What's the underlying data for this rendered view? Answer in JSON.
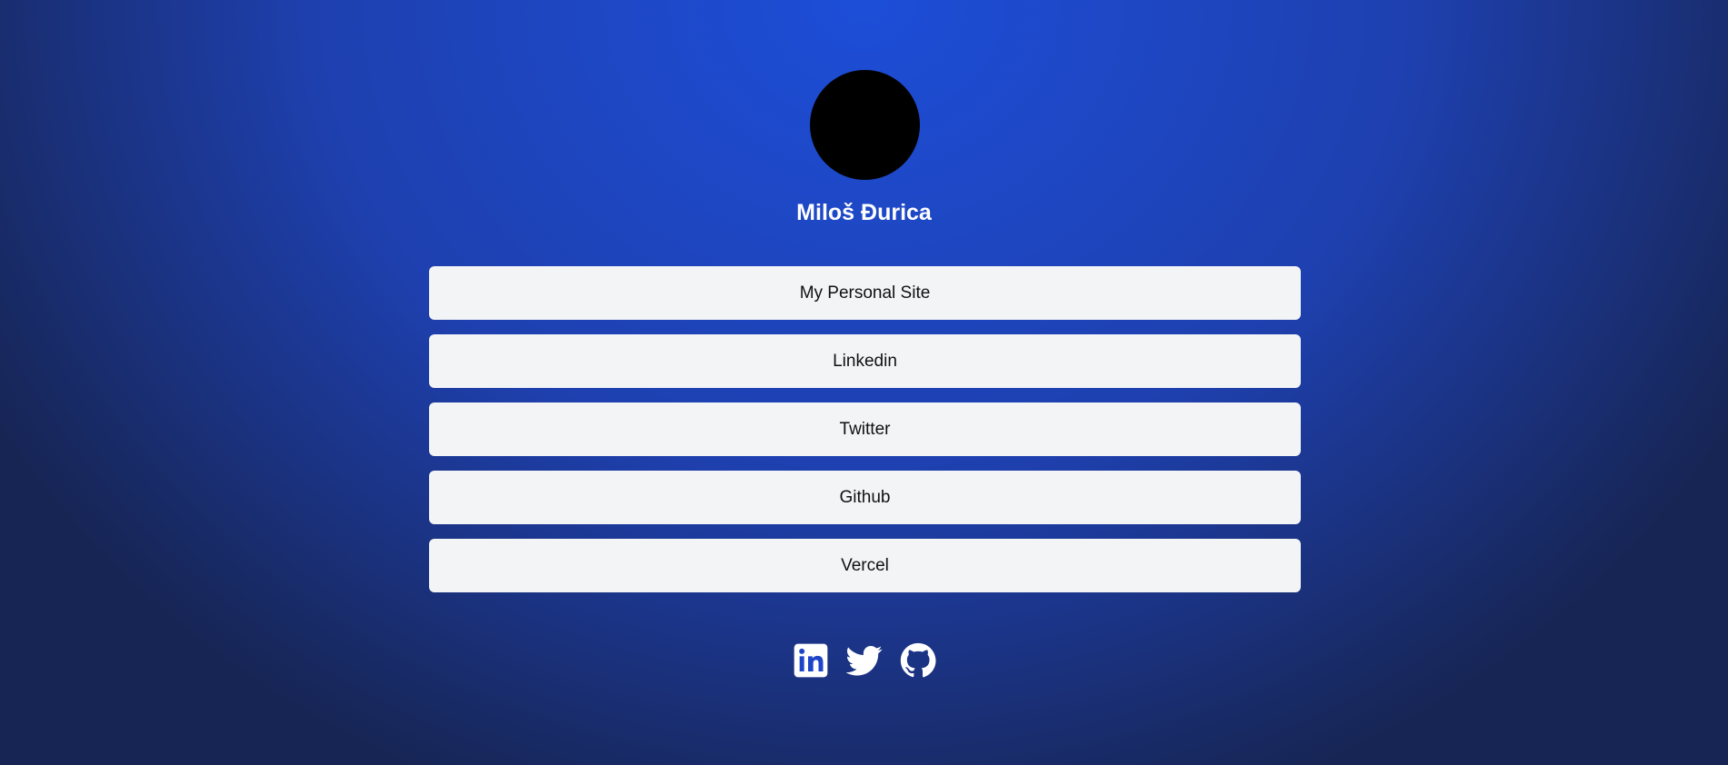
{
  "profile": {
    "name": "Miloš Đurica"
  },
  "links": [
    {
      "label": "My Personal Site"
    },
    {
      "label": "Linkedin"
    },
    {
      "label": "Twitter"
    },
    {
      "label": "Github"
    },
    {
      "label": "Vercel"
    }
  ],
  "socials": [
    {
      "icon": "linkedin-icon"
    },
    {
      "icon": "twitter-icon"
    },
    {
      "icon": "github-icon"
    }
  ],
  "colors": {
    "background_center": "#1d4ed8",
    "background_edge": "#172554",
    "button_bg": "#f3f4f6",
    "button_text": "#111111",
    "avatar": "#000000",
    "text": "#ffffff"
  }
}
